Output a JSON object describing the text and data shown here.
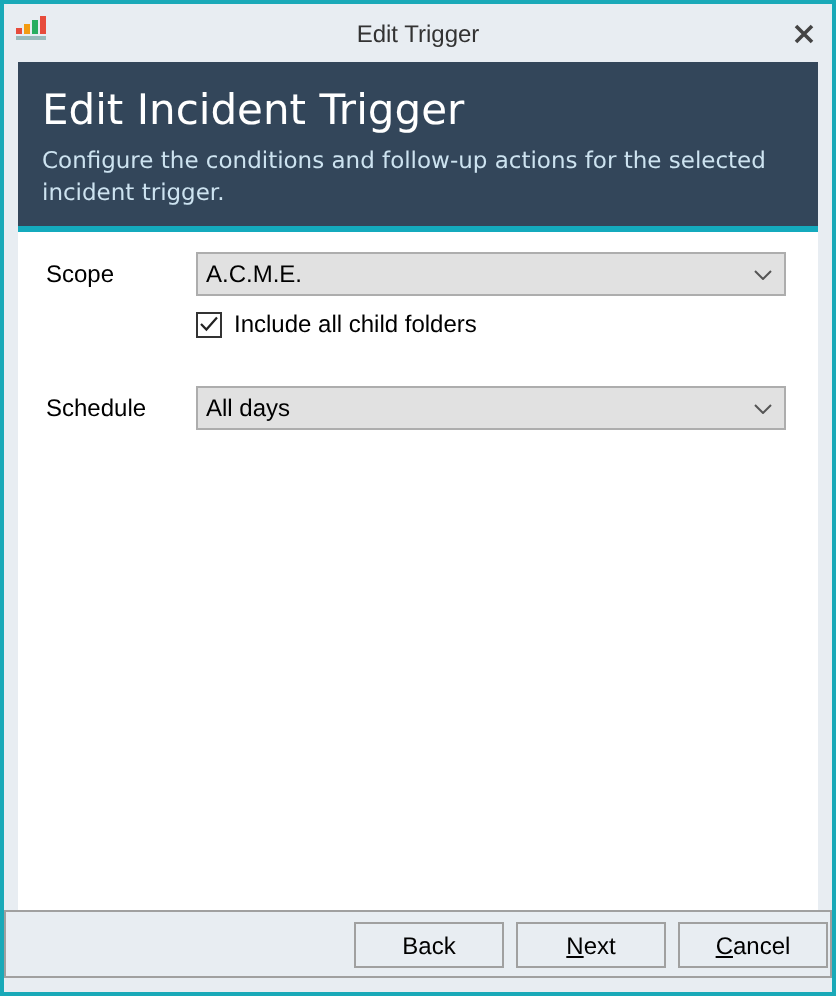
{
  "window": {
    "title": "Edit Trigger"
  },
  "header": {
    "title": "Edit Incident Trigger",
    "subtitle": "Configure the conditions and follow-up actions for the selected incident trigger."
  },
  "fields": [
    {
      "label": "Scope",
      "value": "A.C.M.E.",
      "checkbox": {
        "label": "Include all child folders",
        "checked": true
      }
    },
    {
      "label": "Schedule",
      "value": "All days"
    }
  ],
  "buttons": [
    {
      "label": "Back",
      "mnemonic": false
    },
    {
      "label": "Next",
      "mnemonic": true
    },
    {
      "label": "Cancel",
      "mnemonic": true
    }
  ]
}
